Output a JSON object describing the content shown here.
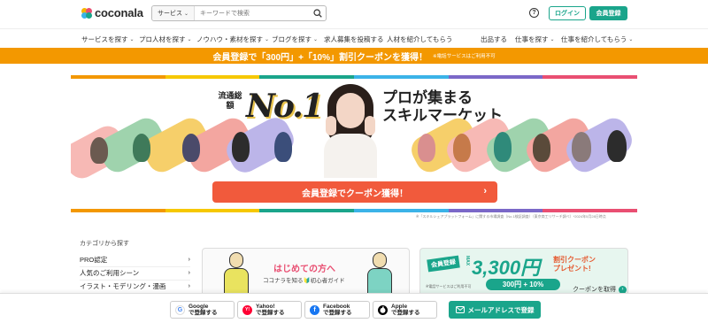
{
  "header": {
    "logo_text": "coconala",
    "search_category": "サービス",
    "search_placeholder": "キーワードで検索",
    "help_label": "?",
    "login_label": "ログイン",
    "register_label": "会員登録"
  },
  "nav": {
    "left": [
      {
        "label": "サービスを探す",
        "caret": true
      },
      {
        "label": "プロ人材を探す",
        "caret": true
      },
      {
        "label": "ノウハウ・素材を探す",
        "caret": true
      },
      {
        "label": "ブログを探す",
        "caret": true
      },
      {
        "label": "求人募集を投稿する",
        "caret": false
      },
      {
        "label": "人材を紹介してもらう",
        "caret": false
      }
    ],
    "right": [
      {
        "label": "出品する",
        "caret": false
      },
      {
        "label": "仕事を探す",
        "caret": true
      },
      {
        "label": "仕事を紹介してもらう",
        "caret": true
      }
    ]
  },
  "promo": {
    "text": "会員登録で「300円」+「10%」割引クーポンを獲得！",
    "note": "※電話サービスはご利用不可"
  },
  "hero": {
    "badge": "流通総額",
    "no1": "No.1",
    "title_line1": "プロが集まる",
    "title_line2": "スキルマーケット",
    "cta": "会員登録でクーポン獲得！",
    "cta_arrow": "›",
    "footnote": "※「スキルシェアプラットフォーム」に関する市場調査（No.1検証調査）（東京商工リサーチ調べ）*2024年5月28日時点"
  },
  "categories": {
    "title": "カテゴリから探す",
    "items": [
      "PRO認定",
      "人気のご利用シーン",
      "イラスト・モデリング・漫画"
    ]
  },
  "beginner": {
    "title": "はじめての方へ",
    "subtitle": "ココナラを知る🔰初心者ガイド"
  },
  "coupon": {
    "register": "会員登録",
    "max": "MAX",
    "amount": "3,300円",
    "present_line1": "割引クーポン",
    "present_line2": "プレゼント!",
    "pct": "300円 + 10%",
    "note": "※電話サービスはご利用不可",
    "get_label": "クーポンを取得",
    "get_arrow": "›"
  },
  "bottom": {
    "social": [
      {
        "name": "Google",
        "sub": "で登録する",
        "glyph": "G",
        "color": "#ffffff",
        "text_color": "#4285f4"
      },
      {
        "name": "Yahoo!",
        "sub": "で登録する",
        "glyph": "Y!",
        "color": "#ff0033",
        "text_color": "#ffffff"
      },
      {
        "name": "Facebook",
        "sub": "で登録する",
        "glyph": "f",
        "color": "#1877f2",
        "text_color": "#ffffff"
      },
      {
        "name": "Apple",
        "sub": "で登録する",
        "glyph": "",
        "color": "#000000",
        "text_color": "#ffffff"
      }
    ],
    "mail_label": "メールアドレスで登録"
  },
  "colors": {
    "accent": "#1aa58b",
    "promo": "#f39800",
    "cta": "#f15a3c"
  }
}
